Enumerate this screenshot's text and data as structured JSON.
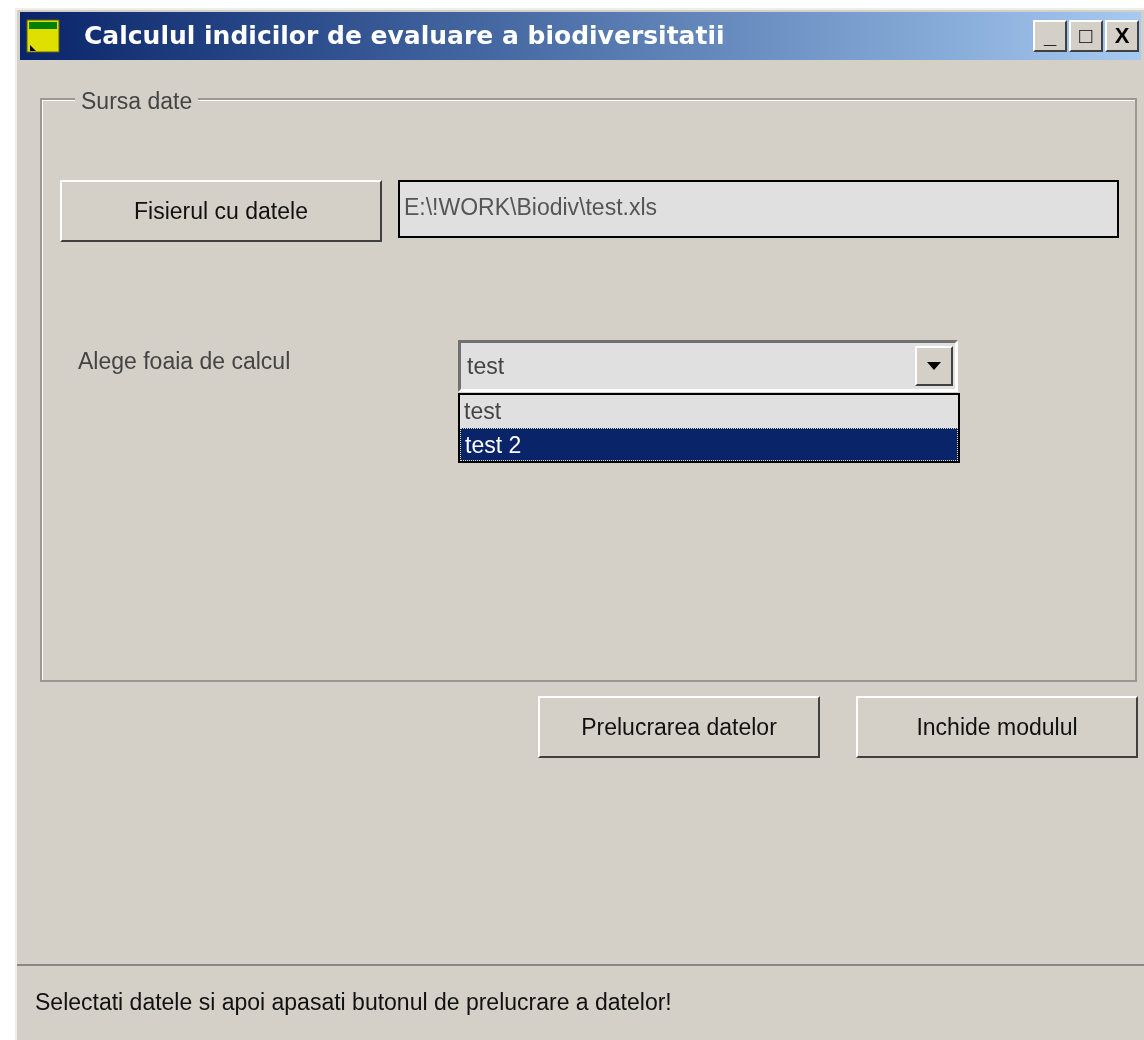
{
  "window": {
    "title": "Calculul indicilor de evaluare a biodiversitatii",
    "controls": [
      "_",
      "□",
      "X"
    ]
  },
  "group": {
    "label": "Sursa date"
  },
  "file_button": "Fisierul cu datele",
  "file_path": {
    "value": "E:\\!WORK\\Biodiv\\test.xls"
  },
  "sheet_label": "Alege foaia de calcul",
  "sheet_combo": {
    "value": "test",
    "expanded": true,
    "options": [
      {
        "label": "test",
        "highlighted": false
      },
      {
        "label": "test 2",
        "highlighted": true
      }
    ]
  },
  "buttons": [
    "Prelucrarea datelor",
    "Inchide modulul"
  ],
  "status_bar": "Selectati datele si apoi apasati butonul de prelucrare a datelor!"
}
